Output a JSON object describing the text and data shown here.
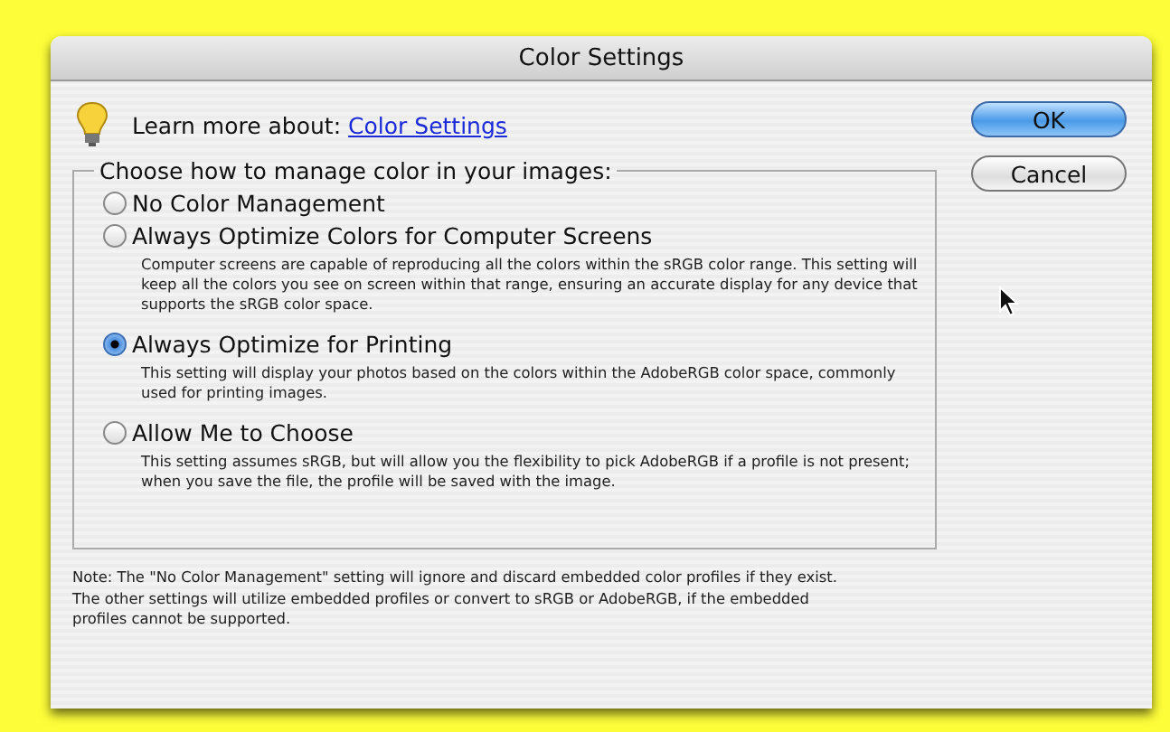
{
  "window": {
    "title": "Color Settings"
  },
  "learn_more": {
    "label": "Learn more about:",
    "link": "Color Settings"
  },
  "buttons": [
    {
      "label": "OK",
      "default": true
    },
    {
      "label": "Cancel",
      "default": false
    }
  ],
  "group": {
    "legend": "Choose how to manage color in your images:",
    "options": [
      {
        "label": "No Color Management",
        "selected": false
      },
      {
        "label": "Always Optimize Colors for Computer Screens",
        "selected": false,
        "description": "Computer screens are capable of reproducing all the colors within the sRGB color range. This setting will keep all the colors you see on screen within that range, ensuring an accurate display for any device that supports the sRGB color space."
      },
      {
        "label": "Always Optimize for Printing",
        "selected": true,
        "description": "This setting will display your photos based on the colors within the AdobeRGB color space, commonly used for printing images."
      },
      {
        "label": "Allow Me to Choose",
        "selected": false,
        "description": "This setting assumes sRGB, but will allow you the flexibility to pick AdobeRGB if a profile is not present; when you save the file, the profile will be saved with the image."
      }
    ]
  },
  "note": "Note: The \"No Color Management\" setting will ignore and discard embedded color profiles if they exist. The other settings will utilize embedded profiles or convert to sRGB or AdobeRGB, if the embedded profiles cannot be supported."
}
